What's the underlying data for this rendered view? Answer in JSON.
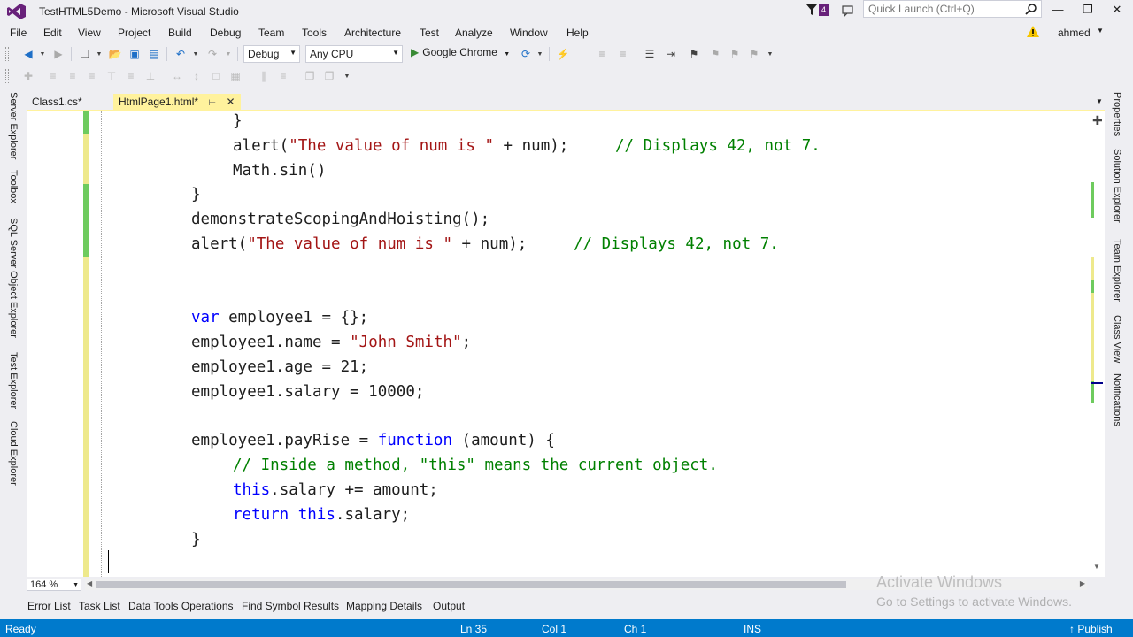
{
  "window": {
    "title": "TestHTML5Demo - Microsoft Visual Studio",
    "notification_count": "4",
    "quick_launch_placeholder": "Quick Launch (Ctrl+Q)",
    "controls": [
      "minimize",
      "restore",
      "close"
    ]
  },
  "menu": {
    "items": [
      "File",
      "Edit",
      "View",
      "Project",
      "Build",
      "Debug",
      "Team",
      "Tools",
      "Architecture",
      "Test",
      "Analyze",
      "Window",
      "Help"
    ],
    "user": "ahmed"
  },
  "toolbar": {
    "config": "Debug",
    "platform": "Any CPU",
    "run_target": "Google Chrome"
  },
  "left_tool_windows": [
    "Server Explorer",
    "Toolbox",
    "SQL Server Object Explorer",
    "Test Explorer",
    "Cloud Explorer"
  ],
  "right_tool_windows": [
    "Properties",
    "Solution Explorer",
    "Team Explorer",
    "Class View",
    "Notifications"
  ],
  "doc_tabs": [
    {
      "label": "Class1.cs*",
      "active": false
    },
    {
      "label": "HtmlPage1.html*",
      "active": true
    }
  ],
  "code_lines": [
    {
      "indent": 2,
      "tokens": [
        {
          "t": "}",
          "c": "p"
        }
      ]
    },
    {
      "indent": 2,
      "tokens": [
        {
          "t": "alert(",
          "c": "p"
        },
        {
          "t": "\"The value of num is \"",
          "c": "str"
        },
        {
          "t": " + num);     ",
          "c": "p"
        },
        {
          "t": "// Displays 42, not 7.",
          "c": "cm"
        }
      ]
    },
    {
      "indent": 2,
      "tokens": [
        {
          "t": "Math.sin()",
          "c": "p"
        }
      ]
    },
    {
      "indent": 1,
      "tokens": [
        {
          "t": "}",
          "c": "p"
        }
      ]
    },
    {
      "indent": 1,
      "tokens": [
        {
          "t": "demonstrateScopingAndHoisting();",
          "c": "p"
        }
      ]
    },
    {
      "indent": 1,
      "tokens": [
        {
          "t": "alert(",
          "c": "p"
        },
        {
          "t": "\"The value of num is \"",
          "c": "str"
        },
        {
          "t": " + num);     ",
          "c": "p"
        },
        {
          "t": "// Displays 42, not 7.",
          "c": "cm"
        }
      ]
    },
    {
      "indent": 0,
      "tokens": []
    },
    {
      "indent": 0,
      "tokens": []
    },
    {
      "indent": 1,
      "tokens": [
        {
          "t": "var",
          "c": "kw"
        },
        {
          "t": " employee1 = {};",
          "c": "p"
        }
      ]
    },
    {
      "indent": 1,
      "tokens": [
        {
          "t": "employee1.name = ",
          "c": "p"
        },
        {
          "t": "\"John Smith\"",
          "c": "str"
        },
        {
          "t": ";",
          "c": "p"
        }
      ]
    },
    {
      "indent": 1,
      "tokens": [
        {
          "t": "employee1.age = 21;",
          "c": "p"
        }
      ]
    },
    {
      "indent": 1,
      "tokens": [
        {
          "t": "employee1.salary = 10000;",
          "c": "p"
        }
      ]
    },
    {
      "indent": 0,
      "tokens": []
    },
    {
      "indent": 1,
      "tokens": [
        {
          "t": "employee1.payRise = ",
          "c": "p"
        },
        {
          "t": "function",
          "c": "kw"
        },
        {
          "t": " (amount) {",
          "c": "p"
        }
      ]
    },
    {
      "indent": 2,
      "tokens": [
        {
          "t": "// Inside a method, \"this\" means the current object.",
          "c": "cm"
        }
      ]
    },
    {
      "indent": 2,
      "tokens": [
        {
          "t": "this",
          "c": "kw"
        },
        {
          "t": ".salary += amount;",
          "c": "p"
        }
      ]
    },
    {
      "indent": 2,
      "tokens": [
        {
          "t": "return",
          "c": "kw"
        },
        {
          "t": " ",
          "c": "p"
        },
        {
          "t": "this",
          "c": "kw"
        },
        {
          "t": ".salary;",
          "c": "p"
        }
      ]
    },
    {
      "indent": 1,
      "tokens": [
        {
          "t": "}",
          "c": "p"
        }
      ]
    },
    {
      "indent": 0,
      "tokens": []
    }
  ],
  "zoom": "164 %",
  "watermark": {
    "line1": "Activate Windows",
    "line2": "Go to Settings to activate Windows."
  },
  "bottom_tabs": [
    "Error List",
    "Task List",
    "Data Tools Operations",
    "Find Symbol Results",
    "Mapping Details",
    "Output"
  ],
  "status": {
    "ready": "Ready",
    "line": "Ln 35",
    "col": "Col 1",
    "ch": "Ch 1",
    "mode": "INS",
    "publish": "Publish"
  },
  "colors": {
    "accent": "#007acc",
    "active_tab": "#fff29d",
    "keyword": "#0000ff",
    "string": "#a31515",
    "comment": "#008000",
    "vs_purple": "#68217a"
  }
}
